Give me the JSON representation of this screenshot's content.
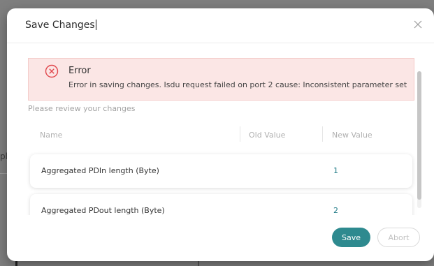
{
  "background": {
    "partial_text": "pl"
  },
  "dialog": {
    "title": "Save Changes",
    "close_icon": "close-icon"
  },
  "error": {
    "icon": "error-circle-x-icon",
    "title": "Error",
    "message": "Error in saving changes. Isdu request failed on port 2 cause: Inconsistent parameter set",
    "color": "#e0474c",
    "background_color": "#fbe6e5"
  },
  "review_prompt": "Please review your changes",
  "table": {
    "headers": {
      "name": "Name",
      "old_value": "Old Value",
      "new_value": "New Value"
    },
    "rows": [
      {
        "name": "Aggregated PDIn length (Byte)",
        "old_value": "",
        "new_value": "1"
      },
      {
        "name": "Aggregated PDout length (Byte)",
        "old_value": "",
        "new_value": "2"
      }
    ]
  },
  "footer": {
    "save_label": "Save",
    "abort_label": "Abort"
  },
  "colors": {
    "accent": "#2e8a8f",
    "new_value_text": "#1f7a86"
  }
}
